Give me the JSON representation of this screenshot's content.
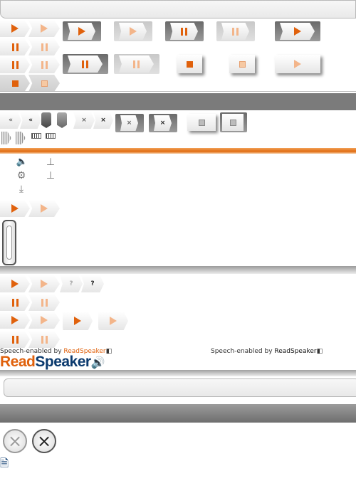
{
  "icons": {
    "play": "play-icon",
    "pause": "pause-icon",
    "stop": "stop-icon",
    "rewind": "rewind-icon",
    "close": "close-icon",
    "help": "help-icon",
    "volume": "volume-icon",
    "settings": "gear-icon",
    "download": "download-icon",
    "pin": "pin-icon"
  },
  "colors": {
    "accent": "#e0610c",
    "accent_light": "#f3b58a",
    "divider_dark": "#7b7b7b",
    "brand_blue": "#0b3a6e"
  },
  "glyphs": {
    "rewind": "«",
    "close_small": "×",
    "help": "?",
    "close_big": "×",
    "volume": "🔈",
    "gear": "⚙",
    "download": "⤓",
    "pin": "⊥"
  },
  "speech": {
    "prefix_left": "Speech-enabled by ",
    "brand_left": "ReadSpeaker",
    "prefix_right": "Speech-enabled by ",
    "brand_right": "ReadSpeaker"
  },
  "logo": {
    "read": "Read",
    "speaker": "Speaker",
    "sound_glyph": "🔊"
  },
  "doc_icon_glyph": "🗎"
}
